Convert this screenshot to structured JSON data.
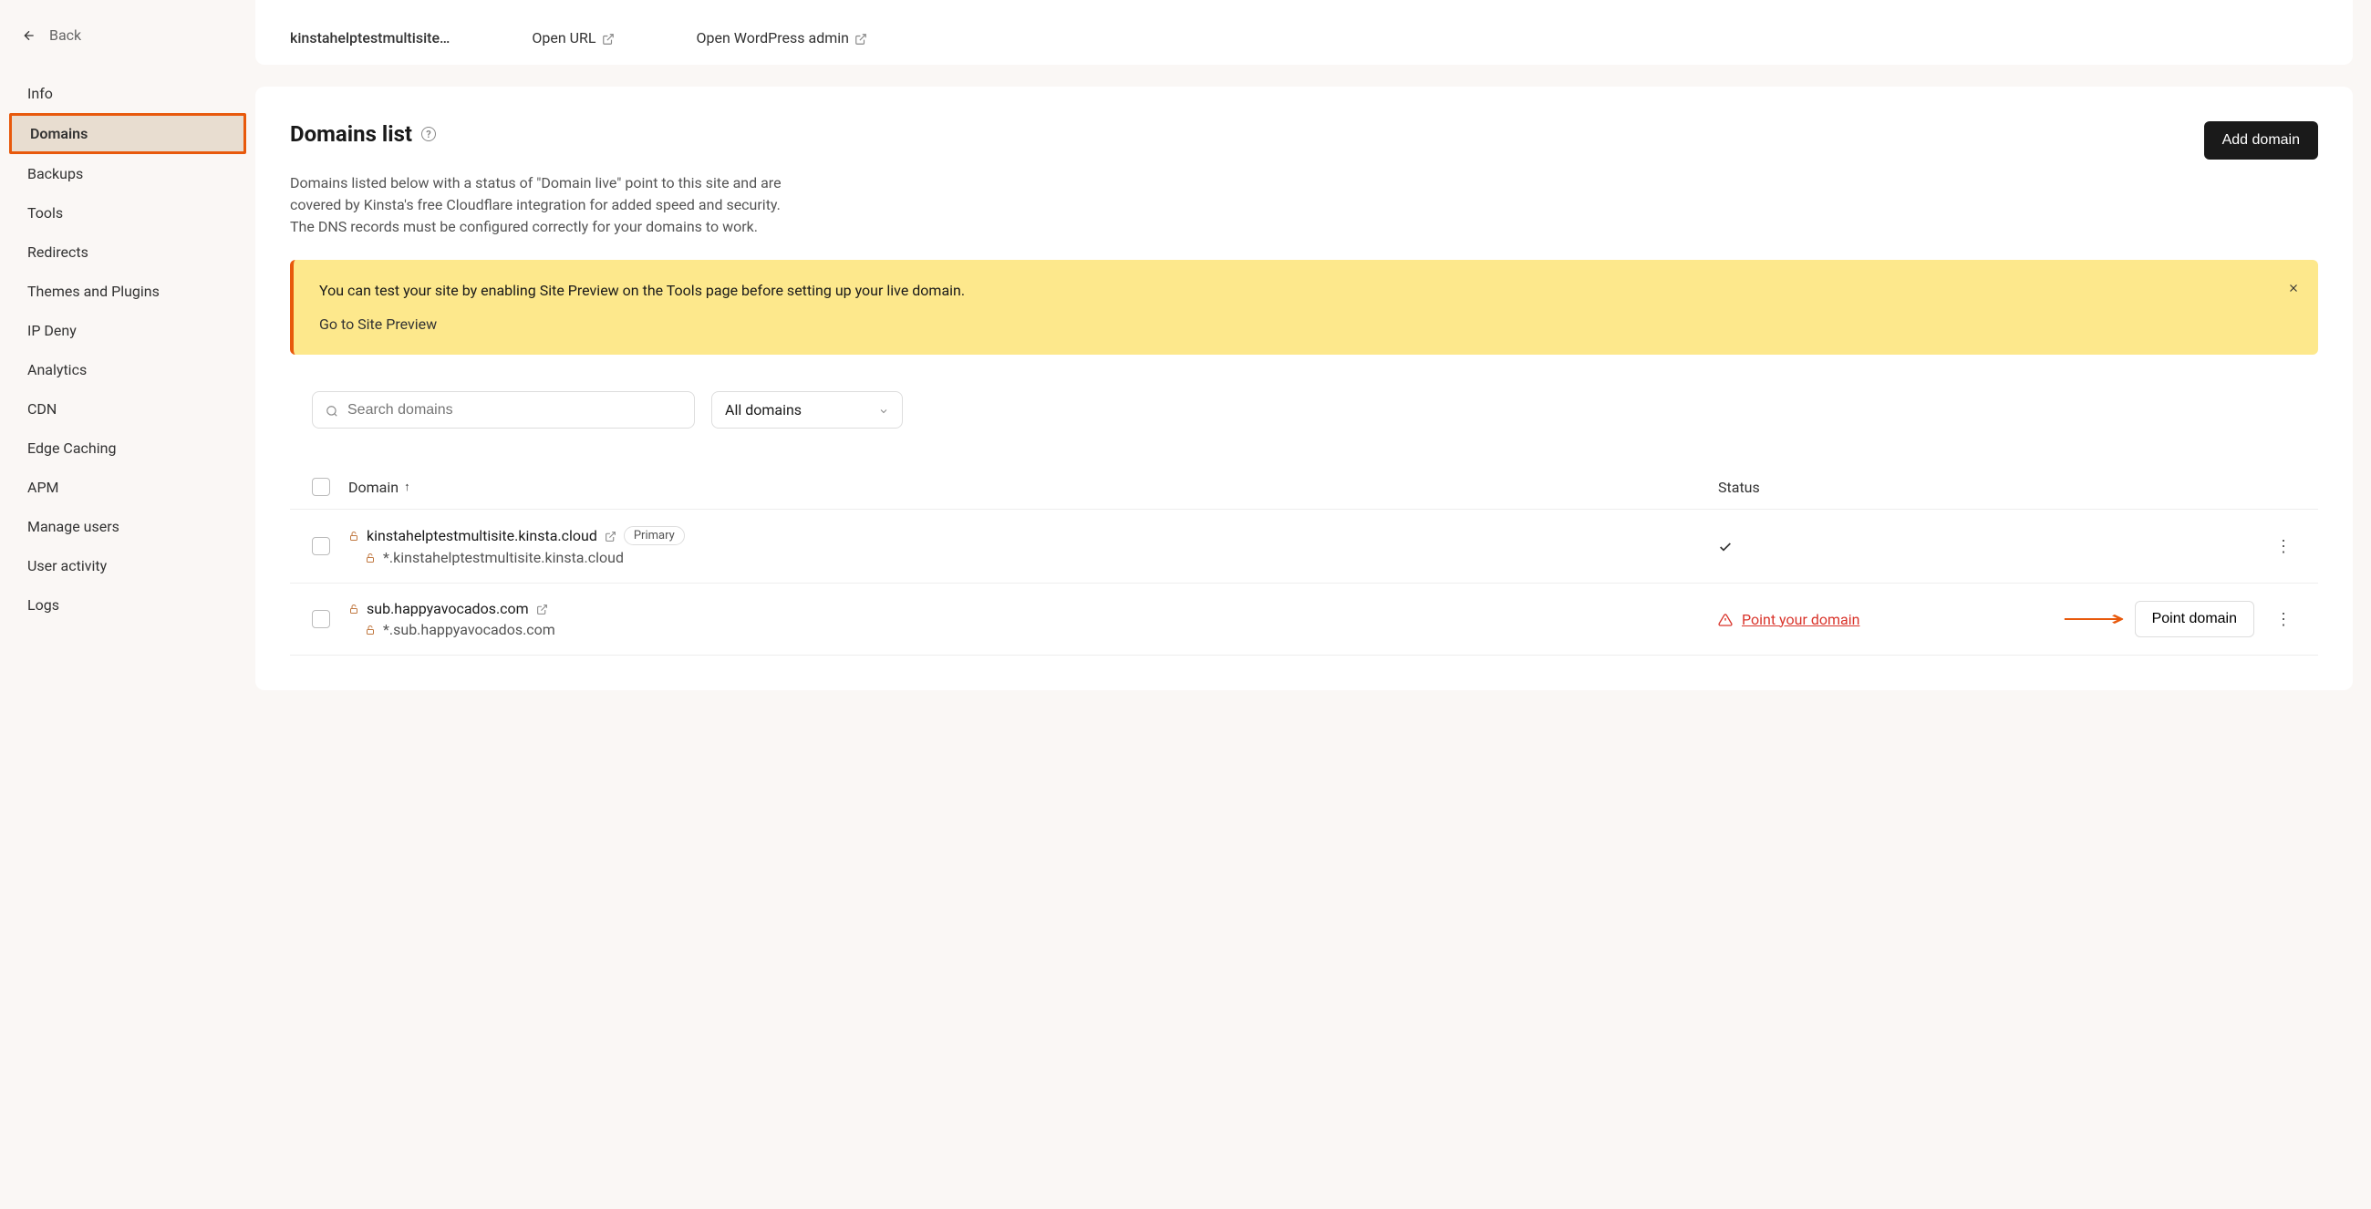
{
  "back": {
    "label": "Back"
  },
  "sidebar": {
    "items": [
      {
        "label": "Info",
        "key": "info"
      },
      {
        "label": "Domains",
        "key": "domains",
        "active": true
      },
      {
        "label": "Backups",
        "key": "backups"
      },
      {
        "label": "Tools",
        "key": "tools"
      },
      {
        "label": "Redirects",
        "key": "redirects"
      },
      {
        "label": "Themes and Plugins",
        "key": "themes-plugins"
      },
      {
        "label": "IP Deny",
        "key": "ip-deny"
      },
      {
        "label": "Analytics",
        "key": "analytics"
      },
      {
        "label": "CDN",
        "key": "cdn"
      },
      {
        "label": "Edge Caching",
        "key": "edge-caching"
      },
      {
        "label": "APM",
        "key": "apm"
      },
      {
        "label": "Manage users",
        "key": "manage-users"
      },
      {
        "label": "User activity",
        "key": "user-activity"
      },
      {
        "label": "Logs",
        "key": "logs"
      }
    ]
  },
  "topbar": {
    "site_name": "kinstahelptestmultisite…",
    "open_url": "Open URL",
    "open_wp": "Open WordPress admin"
  },
  "page": {
    "title": "Domains list",
    "add_button": "Add domain",
    "description": "Domains listed below with a status of \"Domain live\" point to this site and are covered by Kinsta's free Cloudflare integration for added speed and security. The DNS records must be configured correctly for your domains to work."
  },
  "alert": {
    "text": "You can test your site by enabling Site Preview on the Tools page before setting up your live domain.",
    "link": "Go to Site Preview"
  },
  "toolbar": {
    "search_placeholder": "Search domains",
    "filter_label": "All domains"
  },
  "table": {
    "headers": {
      "domain": "Domain",
      "status": "Status"
    },
    "rows": [
      {
        "domain": "kinstahelptestmultisite.kinsta.cloud",
        "wildcard": "*.kinstahelptestmultisite.kinsta.cloud",
        "primary_badge": "Primary",
        "status_type": "ok",
        "action": null
      },
      {
        "domain": "sub.happyavocados.com",
        "wildcard": "*.sub.happyavocados.com",
        "primary_badge": null,
        "status_type": "warn",
        "status_text": "Point your domain",
        "action": "Point domain"
      }
    ]
  }
}
